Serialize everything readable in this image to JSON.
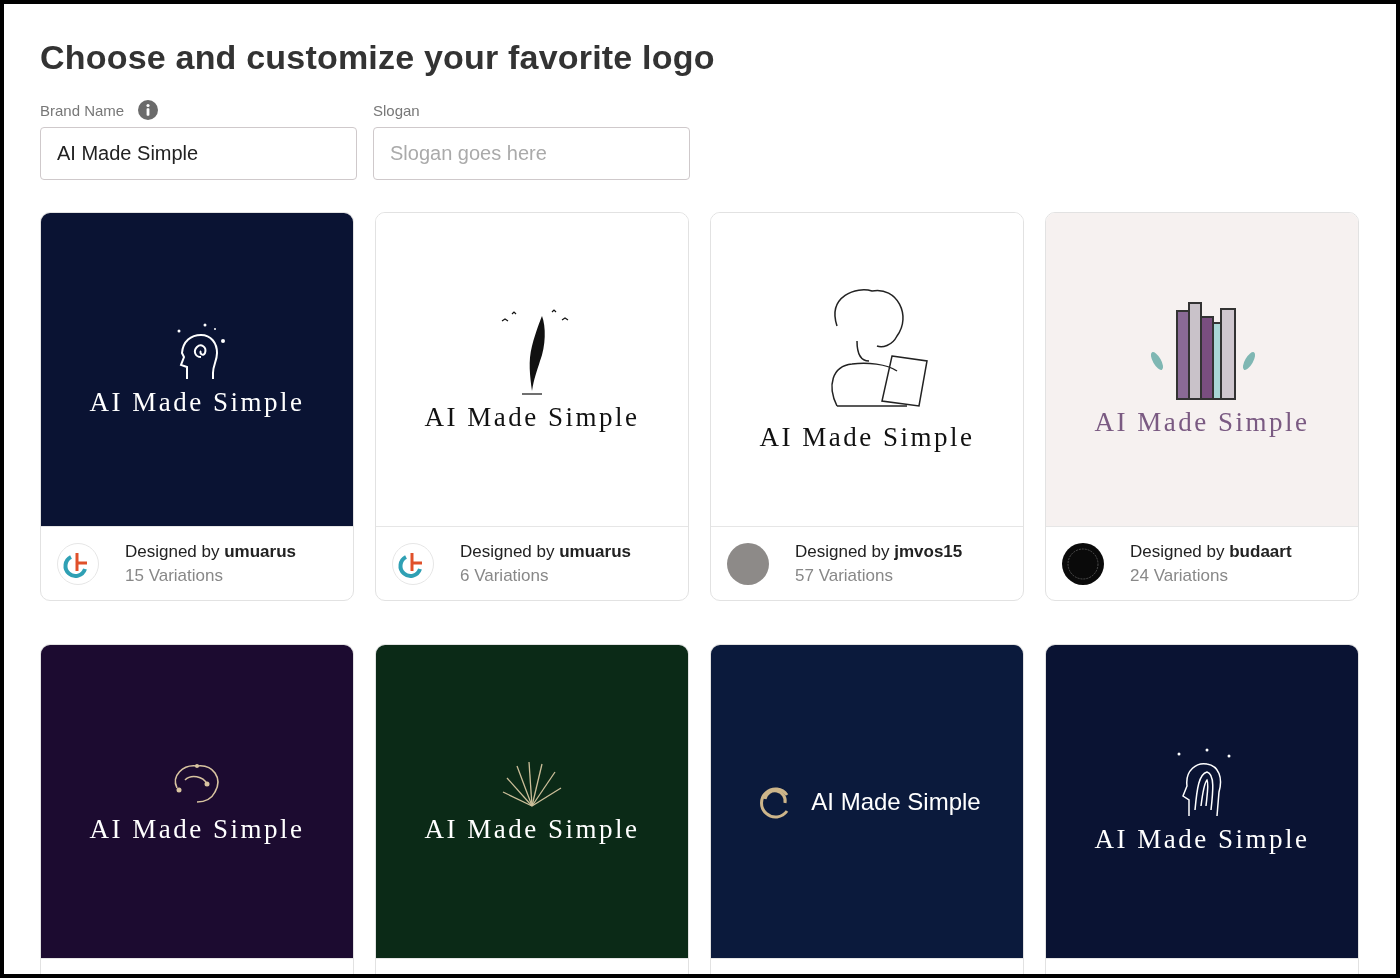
{
  "title": "Choose and customize your favorite logo",
  "fields": [
    {
      "label": "Brand Name",
      "info": true,
      "value": "AI Made Simple"
    },
    {
      "label": "Slogan",
      "info": false,
      "placeholder": "Slogan goes here"
    }
  ],
  "cards": [
    {
      "color": "#0a1333",
      "kind": "head",
      "logo_text": "AI Made Simple",
      "footer": {
        "kind": "monogram",
        "prefix": "Designed by",
        "designer": "umuarus",
        "variations": "15 Variations"
      }
    },
    {
      "color": "#ffffff",
      "kind": "feather",
      "logo_text": "AI Made Simple",
      "footer": {
        "kind": "monogram",
        "prefix": "Designed by",
        "designer": "umuarus",
        "variations": "6 Variations"
      }
    },
    {
      "color": "#ffffff",
      "kind": "laptop",
      "logo_text": "AI Made Simple",
      "footer": {
        "kind": "photo",
        "prefix": "Designed by",
        "designer": "jmvos15",
        "variations": "57 Variations"
      }
    },
    {
      "color": "#f6f1f0",
      "kind": "books",
      "logo_text": "AI Made Simple",
      "footer": {
        "kind": "badge",
        "prefix": "Designed by",
        "designer": "budaart",
        "variations": "24 Variations"
      }
    },
    {
      "color": "#1c0b30",
      "kind": "brain",
      "logo_text": "AI Made Simple"
    },
    {
      "color": "#0b2a17",
      "kind": "bush",
      "logo_text": "AI Made Simple"
    },
    {
      "color": "#0b1a3c",
      "kind": "rings",
      "logo_text": "AI Made Simple"
    },
    {
      "color": "#0a1333",
      "kind": "profile",
      "logo_text": "AI Made Simple"
    }
  ]
}
